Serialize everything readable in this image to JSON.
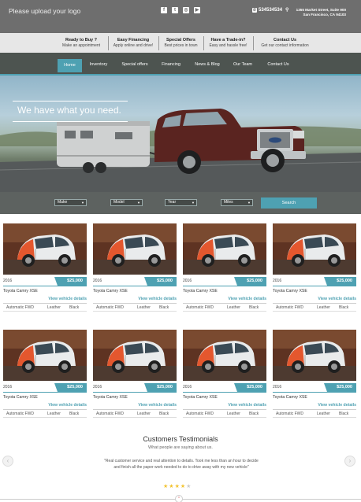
{
  "header": {
    "logo_text": "Please upload your logo",
    "social_icons": [
      "facebook-icon",
      "twitter-icon",
      "instagram-icon",
      "youtube-icon"
    ],
    "phone": "534534534",
    "address": "1355 Market Street, Suite 900 San Francisco, CA 94103"
  },
  "infobar": [
    {
      "title": "Ready to Buy ?",
      "subtitle": "Make an appointment"
    },
    {
      "title": "Easy Financing",
      "subtitle": "Apply online and drive!"
    },
    {
      "title": "Special Offers",
      "subtitle": "Best prices in town"
    },
    {
      "title": "Have a Trade-in?",
      "subtitle": "Easy and hassle free!"
    },
    {
      "title": "Contact Us",
      "subtitle": "Get our contact information"
    }
  ],
  "nav": {
    "items": [
      "Home",
      "Inventory",
      "Special offers",
      "Financing",
      "News & Blog",
      "Our Team",
      "Contact Us"
    ],
    "active": "Home"
  },
  "hero": {
    "headline": "We have what you need."
  },
  "search": {
    "make": "Make",
    "model": "Model",
    "year": "Year",
    "miles": "Miles",
    "button": "Search"
  },
  "vehicles": [
    {
      "year": "2016",
      "price": "$25,000",
      "name": "Toyota Camry XSE",
      "details": "View vehicle details",
      "transmission": "Automatic FWD",
      "interior": "Leather",
      "color": "Black"
    },
    {
      "year": "2016",
      "price": "$25,000",
      "name": "Toyota Camry XSE",
      "details": "View vehicle details",
      "transmission": "Automatic FWD",
      "interior": "Leather",
      "color": "Black"
    },
    {
      "year": "2016",
      "price": "$25,000",
      "name": "Toyota Camry XSE",
      "details": "View vehicle details",
      "transmission": "Automatic FWD",
      "interior": "Leather",
      "color": "Black"
    },
    {
      "year": "2016",
      "price": "$25,000",
      "name": "Toyota Camry XSE",
      "details": "View vehicle details",
      "transmission": "Automatic FWD",
      "interior": "Leather",
      "color": "Black"
    },
    {
      "year": "2016",
      "price": "$25,000",
      "name": "Toyota Camry XSE",
      "details": "View vehicle details",
      "transmission": "Automatic FWD",
      "interior": "Leather",
      "color": "Black"
    },
    {
      "year": "2016",
      "price": "$25,000",
      "name": "Toyota Camry XSE",
      "details": "View vehicle details",
      "transmission": "Automatic FWD",
      "interior": "Leather",
      "color": "Black"
    },
    {
      "year": "2016",
      "price": "$25,000",
      "name": "Toyota Camry XSE",
      "details": "View vehicle details",
      "transmission": "Automatic FWD",
      "interior": "Leather",
      "color": "Black"
    },
    {
      "year": "2016",
      "price": "$25,000",
      "name": "Toyota Camry XSE",
      "details": "View vehicle details",
      "transmission": "Automatic FWD",
      "interior": "Leather",
      "color": "Black"
    }
  ],
  "testimonials": {
    "title": "Customers Testimonials",
    "subtitle": "What people are saying about us.",
    "quote": "\"Real customer service and real attention to details. Took me less than an hour to decide and finish all the paper work needed to do to drive away with my new vehicle\"",
    "rating": 4,
    "max_rating": 5
  },
  "colors": {
    "accent": "#4ea1b2",
    "topbar": "#6e6e6e",
    "navbar": "#4d5450",
    "star": "#f3c431"
  }
}
